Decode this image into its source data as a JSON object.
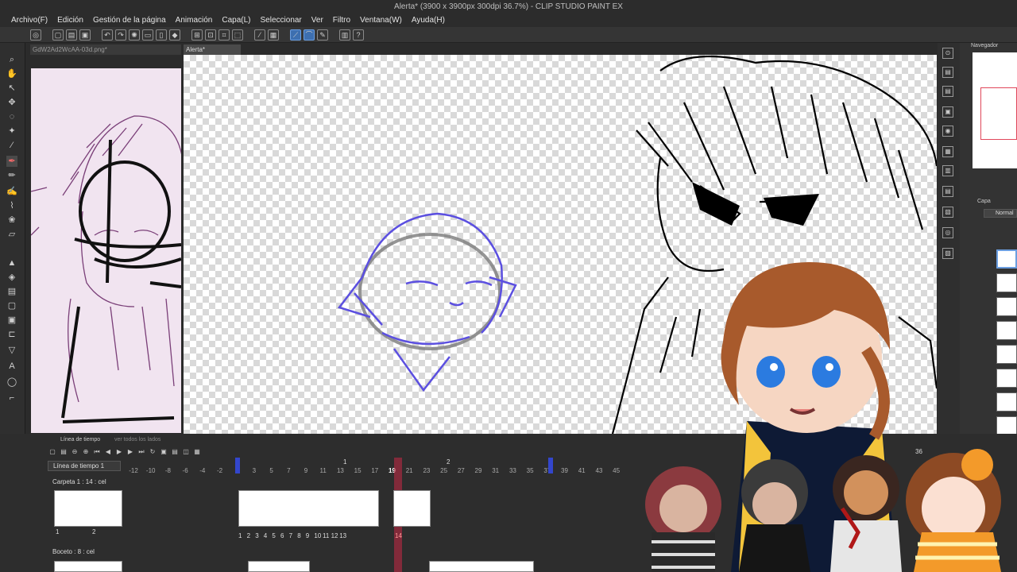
{
  "window": {
    "title": "Alerta* (3900 x 3900px 300dpi 36.7%) - CLIP STUDIO PAINT EX"
  },
  "menu": [
    "Archivo(F)",
    "Edición",
    "Gestión de la página",
    "Animación",
    "Capa(L)",
    "Seleccionar",
    "Ver",
    "Filtro",
    "Ventana(W)",
    "Ayuda(H)"
  ],
  "tabs": {
    "reference": "GdW2Ad2WcAA-03d.png*",
    "canvas": "Alerta*"
  },
  "navigator": {
    "title": "Navegador"
  },
  "layers": {
    "title": "Capa",
    "blend_mode": "Normal"
  },
  "timeline": {
    "panel_title": "Línea de tiempo",
    "panel_tab2": "ver todos los lados",
    "name": "Línea de tiempo 1",
    "tracks": [
      "Carpeta 1 : 14 : cel",
      "Boceto : 8 : cel"
    ],
    "ruler": [
      "-12",
      "-10",
      "-8",
      "-6",
      "-4",
      "-2",
      "0",
      "3",
      "5",
      "7",
      "9",
      "11",
      "13",
      "15",
      "17",
      "19",
      "21",
      "23",
      "25",
      "27",
      "29",
      "31",
      "33",
      "35",
      "37",
      "39",
      "41",
      "43",
      "45"
    ],
    "current_frame": "19",
    "marker": "2",
    "marker_left": "1",
    "end_frame": "36",
    "cel_numbers": [
      "1",
      "2",
      "3",
      "4",
      "5",
      "6",
      "7",
      "8",
      "9",
      "10",
      "11",
      "12",
      "13"
    ],
    "left_cel_numbers": [
      "1",
      "2"
    ],
    "highlight_cel": "14"
  },
  "colors": {
    "accent": "#3d6fb0",
    "playhead": "#c83046",
    "stroke_blue": "#5b4fe0"
  }
}
